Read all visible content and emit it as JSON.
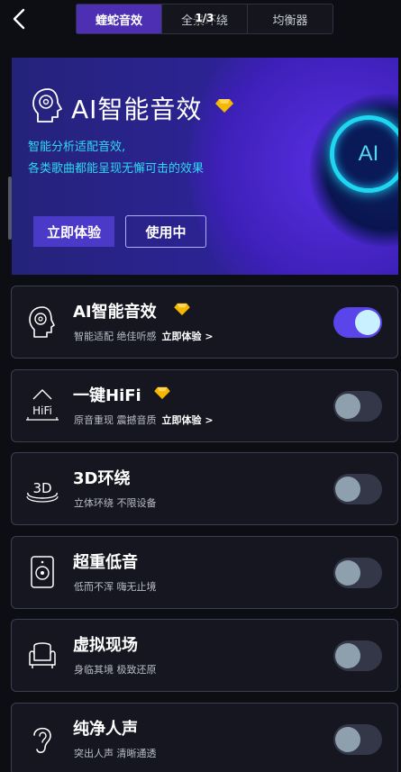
{
  "header": {
    "tabs": [
      {
        "label": "蝰蛇音效",
        "active": true
      },
      {
        "label": "全景环绕",
        "active": false
      },
      {
        "label": "均衡器",
        "active": false
      }
    ],
    "page_indicator": "1/3"
  },
  "banner": {
    "title": "AI智能音效",
    "desc_line1": "智能分析适配音效,",
    "desc_line2": "各类歌曲都能呈现无懈可击的效果",
    "try_button": "立即体验",
    "using_button": "使用中",
    "emblem_text": "AI"
  },
  "cards": [
    {
      "title": "AI智能音效",
      "subtitle": "智能适配 绝佳听感",
      "try_link": "立即体验 >",
      "premium": true,
      "enabled": true,
      "icon": "ai-head-icon"
    },
    {
      "title": "一键HiFi",
      "subtitle": "原音重现 震撼音质",
      "try_link": "立即体验 >",
      "premium": true,
      "enabled": false,
      "icon": "hifi-icon"
    },
    {
      "title": "3D环绕",
      "subtitle": "立体环绕 不限设备",
      "try_link": "",
      "premium": false,
      "enabled": false,
      "icon": "3d-icon"
    },
    {
      "title": "超重低音",
      "subtitle": "低而不浑 嗨无止境",
      "try_link": "",
      "premium": false,
      "enabled": false,
      "icon": "speaker-icon"
    },
    {
      "title": "虚拟现场",
      "subtitle": "身临其境 极致还原",
      "try_link": "",
      "premium": false,
      "enabled": false,
      "icon": "armchair-icon"
    },
    {
      "title": "纯净人声",
      "subtitle": "突出人声 清晰通透",
      "try_link": "",
      "premium": false,
      "enabled": false,
      "icon": "ear-icon"
    }
  ],
  "colors": {
    "accent": "#4c2fb3",
    "toggle_on": "#5a45ea",
    "banner_text": "#2fd8f2",
    "premium": "#f5b800"
  }
}
